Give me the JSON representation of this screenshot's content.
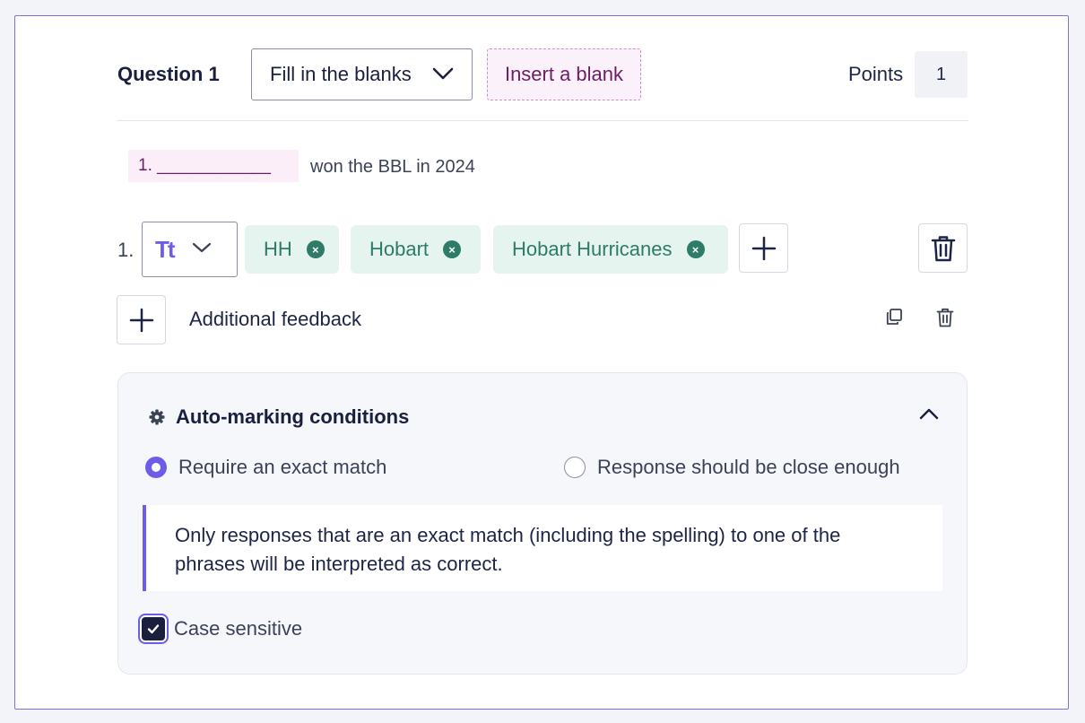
{
  "header": {
    "question_title": "Question 1",
    "question_type": "Fill in the blanks",
    "insert_blank_label": "Insert a blank",
    "points_label": "Points",
    "points_value": "1"
  },
  "question": {
    "blank_label": "1. ____________",
    "text_after_blank": "won the BBL in 2024"
  },
  "answers": {
    "row_number": "1.",
    "type_icon": "Tt",
    "accepted": [
      "HH",
      "Hobart",
      "Hobart Hurricanes"
    ],
    "remove_glyph": "×"
  },
  "feedback": {
    "label": "Additional feedback"
  },
  "auto_marking": {
    "title": "Auto-marking conditions",
    "options": [
      "Require an exact match",
      "Response should be close enough"
    ],
    "selected_index": 0,
    "description": "Only responses that are an exact match (including the spelling) to one of the phrases will be interpreted as correct.",
    "case_sensitive_label": "Case sensitive",
    "case_sensitive": true
  },
  "colors": {
    "accent": "#6c5ce7",
    "tag_bg": "#e6f4ef",
    "tag_text": "#2d7b68",
    "blank_text": "#6d1d63",
    "border": "#7b74d6"
  }
}
